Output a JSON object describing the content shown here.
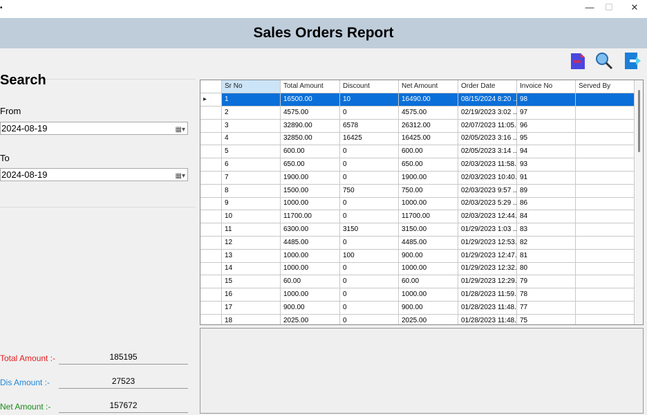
{
  "window": {
    "title": "Sales Orders Report",
    "minimize": "—",
    "maximize": "☐",
    "close": "✕"
  },
  "toolbar": {
    "pdf_icon": "pdf-file-icon",
    "search_icon": "magnifier-icon",
    "exit_icon": "exit-icon"
  },
  "search": {
    "heading": "Search",
    "from_label": "From",
    "from_value": "2024-08-19",
    "to_label": "To",
    "to_value": "2024-08-19"
  },
  "totals": {
    "total_label": "Total Amount :-",
    "total_value": "185195",
    "dis_label": "Dis Amount :-",
    "dis_value": "27523",
    "net_label": "Net Amount :-",
    "net_value": "157672",
    "colors": {
      "total": "#e02020",
      "dis": "#1e88d8",
      "net": "#1a8a1a"
    }
  },
  "grid": {
    "columns": [
      "Sr No",
      "Total Amount",
      "Discount",
      "Net Amount",
      "Order Date",
      "Invoice No",
      "Served By"
    ],
    "rows": [
      [
        "1",
        "16500.00",
        "10",
        "16490.00",
        "08/15/2024 8:20 ...",
        "98",
        ""
      ],
      [
        "2",
        "4575.00",
        "0",
        "4575.00",
        "02/19/2023 3:02 ...",
        "97",
        ""
      ],
      [
        "3",
        "32890.00",
        "6578",
        "26312.00",
        "02/07/2023 11:05...",
        "96",
        ""
      ],
      [
        "4",
        "32850.00",
        "16425",
        "16425.00",
        "02/05/2023 3:16 ...",
        "95",
        ""
      ],
      [
        "5",
        "600.00",
        "0",
        "600.00",
        "02/05/2023 3:14 ...",
        "94",
        ""
      ],
      [
        "6",
        "650.00",
        "0",
        "650.00",
        "02/03/2023 11:58...",
        "93",
        ""
      ],
      [
        "7",
        "1900.00",
        "0",
        "1900.00",
        "02/03/2023 10:40...",
        "91",
        ""
      ],
      [
        "8",
        "1500.00",
        "750",
        "750.00",
        "02/03/2023 9:57 ...",
        "89",
        ""
      ],
      [
        "9",
        "1000.00",
        "0",
        "1000.00",
        "02/03/2023 5:29 ...",
        "86",
        ""
      ],
      [
        "10",
        "11700.00",
        "0",
        "11700.00",
        "02/03/2023 12:44...",
        "84",
        ""
      ],
      [
        "11",
        "6300.00",
        "3150",
        "3150.00",
        "01/29/2023 1:03 ...",
        "83",
        ""
      ],
      [
        "12",
        "4485.00",
        "0",
        "4485.00",
        "01/29/2023 12:53...",
        "82",
        ""
      ],
      [
        "13",
        "1000.00",
        "100",
        "900.00",
        "01/29/2023 12:47...",
        "81",
        ""
      ],
      [
        "14",
        "1000.00",
        "0",
        "1000.00",
        "01/29/2023 12:32...",
        "80",
        ""
      ],
      [
        "15",
        "60.00",
        "0",
        "60.00",
        "01/29/2023 12:29...",
        "79",
        ""
      ],
      [
        "16",
        "1000.00",
        "0",
        "1000.00",
        "01/28/2023 11:59...",
        "78",
        ""
      ],
      [
        "17",
        "900.00",
        "0",
        "900.00",
        "01/28/2023 11:48...",
        "77",
        ""
      ],
      [
        "18",
        "2025.00",
        "0",
        "2025.00",
        "01/28/2023 11:48...",
        "75",
        ""
      ]
    ],
    "selected_row": 0,
    "selection_color": "#0a6fd8"
  }
}
